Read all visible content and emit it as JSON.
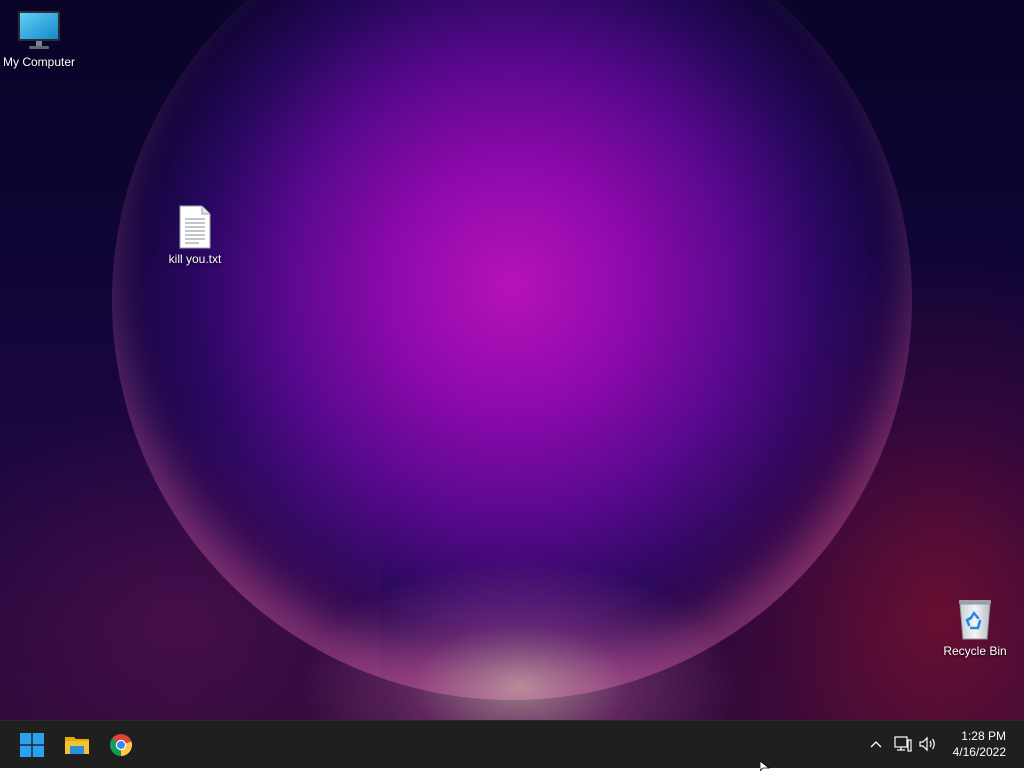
{
  "desktop": {
    "icons": {
      "my_computer": {
        "label": "My Computer",
        "icon": "monitor-icon"
      },
      "text_file": {
        "label": "kill you.txt",
        "icon": "text-file-icon"
      },
      "recycle_bin": {
        "label": "Recycle Bin",
        "icon": "recycle-bin-icon"
      }
    }
  },
  "taskbar": {
    "pinned": [
      {
        "name": "Start",
        "icon": "windows-logo-icon"
      },
      {
        "name": "File Explorer",
        "icon": "folder-icon"
      },
      {
        "name": "Google Chrome",
        "icon": "chrome-icon"
      }
    ],
    "tray": {
      "icons": [
        "chevron-up-icon",
        "network-icon",
        "volume-icon"
      ],
      "time": "1:28 PM",
      "date": "4/16/2022"
    }
  },
  "colors": {
    "taskbar_bg": "#1f1f1f",
    "accent_blue": "#29a3f0",
    "folder_yellow": "#f4c430"
  }
}
